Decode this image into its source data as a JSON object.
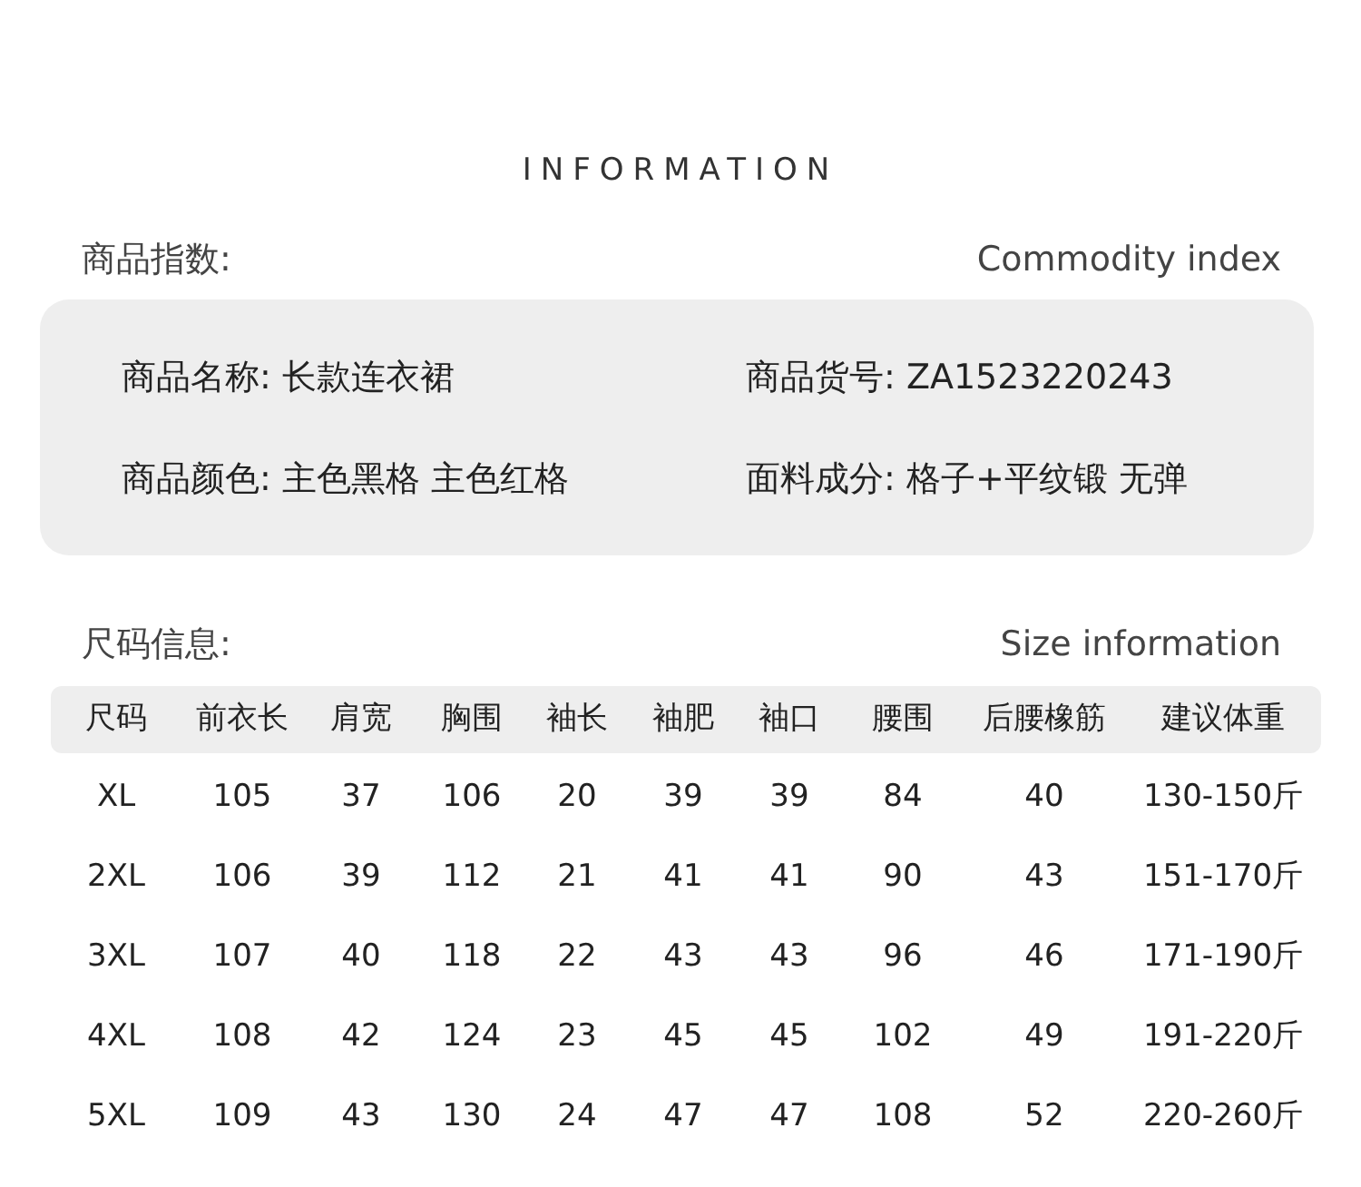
{
  "title": "INFORMATION",
  "commodity": {
    "heading": "商品指数:",
    "heading_en": "Commodity index",
    "fields": [
      {
        "label": "商品名称:",
        "value": "长款连衣裙"
      },
      {
        "label": "商品货号:",
        "value": "ZA1523220243"
      },
      {
        "label": "商品颜色:",
        "value": "主色黑格 主色红格"
      },
      {
        "label": "面料成分:",
        "value": "格子+平纹锻 无弹"
      }
    ]
  },
  "size": {
    "heading": "尺码信息:",
    "heading_en": "Size information",
    "columns": [
      "尺码",
      "前衣长",
      "肩宽",
      "胸围",
      "袖长",
      "袖肥",
      "袖口",
      "腰围",
      "后腰橡筋",
      "建议体重"
    ],
    "rows": [
      [
        "XL",
        "105",
        "37",
        "106",
        "20",
        "39",
        "39",
        "84",
        "40",
        "130-150斤"
      ],
      [
        "2XL",
        "106",
        "39",
        "112",
        "21",
        "41",
        "41",
        "90",
        "43",
        "151-170斤"
      ],
      [
        "3XL",
        "107",
        "40",
        "118",
        "22",
        "43",
        "43",
        "96",
        "46",
        "171-190斤"
      ],
      [
        "4XL",
        "108",
        "42",
        "124",
        "23",
        "45",
        "45",
        "102",
        "49",
        "191-220斤"
      ],
      [
        "5XL",
        "109",
        "43",
        "130",
        "24",
        "47",
        "47",
        "108",
        "52",
        "220-260斤"
      ]
    ]
  }
}
